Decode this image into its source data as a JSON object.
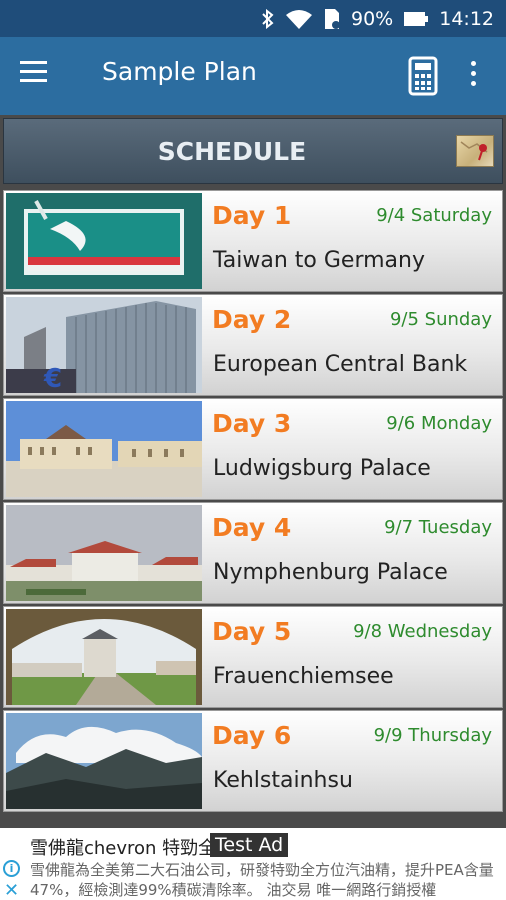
{
  "status_bar": {
    "battery_percent": "90%",
    "time": "14:12",
    "icons": [
      "bluetooth-icon",
      "wifi-icon",
      "sim-icon",
      "battery-icon"
    ]
  },
  "app_bar": {
    "title": "Sample Plan",
    "icons": [
      "menu-icon",
      "calculator-icon",
      "more-vert-icon"
    ]
  },
  "schedule": {
    "title": "SCHEDULE",
    "map_icon": "map-icon"
  },
  "days": [
    {
      "day": "Day 1",
      "date": "9/4 Saturday",
      "place": "Taiwan to Germany"
    },
    {
      "day": "Day 2",
      "date": "9/5 Sunday",
      "place": "European Central Bank"
    },
    {
      "day": "Day 3",
      "date": "9/6 Monday",
      "place": "Ludwigsburg Palace"
    },
    {
      "day": "Day 4",
      "date": "9/7 Tuesday",
      "place": "Nymphenburg Palace"
    },
    {
      "day": "Day 5",
      "date": "9/8 Wednesday",
      "place": "Frauenchiemsee"
    },
    {
      "day": "Day 6",
      "date": "9/9 Thursday",
      "place": "Kehlstainhsu"
    }
  ],
  "ad": {
    "badge": "Test Ad",
    "title": "雪佛龍chevron 特勁全效汽油精",
    "description": "雪佛龍為全美第二大石油公司，研發特勁全方位汽油精，提升PEA含量47%，經檢測達99%積碳清除率。 油交易 唯一網路行銷授權"
  },
  "colors": {
    "status_bar": "#1f4d7a",
    "app_bar": "#2c6da0",
    "day_label": "#f27c22",
    "date_label": "#2e8b2e"
  }
}
